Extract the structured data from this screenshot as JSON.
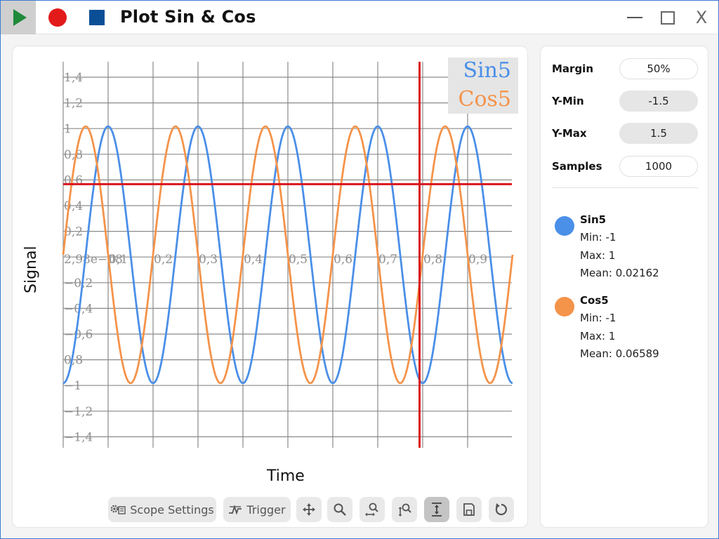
{
  "window": {
    "title": "Plot Sin & Cos",
    "close_glyph": "X"
  },
  "plot": {
    "xlabel": "Time",
    "ylabel": "Signal",
    "cursor_x": 0.793,
    "cursor_y": 0.55
  },
  "chart_data": {
    "type": "line",
    "title": "",
    "xlabel": "Time",
    "ylabel": "Signal",
    "xlim": [
      0,
      1
    ],
    "ylim": [
      -1.5,
      1.5
    ],
    "grid": true,
    "legend_position": "top-right",
    "x_ticks": [
      "2,98e−08",
      "0,1",
      "0,2",
      "0,3",
      "0,4",
      "0,5",
      "0,6",
      "0,7",
      "0,8",
      "0,9"
    ],
    "y_ticks": [
      "1,4",
      "1,2",
      "1",
      "0,8",
      "0,6",
      "0,4",
      "0,2",
      "",
      "−0,2",
      "−0,4",
      "−0,6",
      "0,8",
      "−1",
      "−1,2",
      "−1,4"
    ],
    "series": [
      {
        "name": "Sin5",
        "color": "#4a8fe8",
        "function": "sin",
        "frequency": 5,
        "amplitude": 1,
        "phase_deg": 270,
        "samples": 1000
      },
      {
        "name": "Cos5",
        "color": "#f4934a",
        "function": "cos",
        "frequency": 5,
        "amplitude": 1,
        "phase_deg": 270,
        "samples": 1000
      }
    ]
  },
  "toolbar": {
    "scope_settings_label": "Scope Settings",
    "trigger_label": "Trigger",
    "icons": [
      "move-icon",
      "zoom-icon",
      "zoom-x-icon",
      "zoom-y-icon",
      "fit-vertical-icon",
      "save-icon",
      "reset-icon"
    ]
  },
  "settings": {
    "margin_label": "Margin",
    "margin_value": "50%",
    "ymin_label": "Y-Min",
    "ymin_value": "-1.5",
    "ymax_label": "Y-Max",
    "ymax_value": "1.5",
    "samples_label": "Samples",
    "samples_value": "1000"
  },
  "stats": [
    {
      "name": "Sin5",
      "color": "#4a8fe8",
      "min": "Min: -1",
      "max": "Max: 1",
      "mean": "Mean: 0.02162"
    },
    {
      "name": "Cos5",
      "color": "#f4934a",
      "min": "Min: -1",
      "max": "Max: 1",
      "mean": "Mean: 0.06589"
    }
  ],
  "colors": {
    "accent_play": "#1f8a3b",
    "record": "#e21a1a",
    "stop": "#0a4f96",
    "cursor": "#d9161e"
  }
}
